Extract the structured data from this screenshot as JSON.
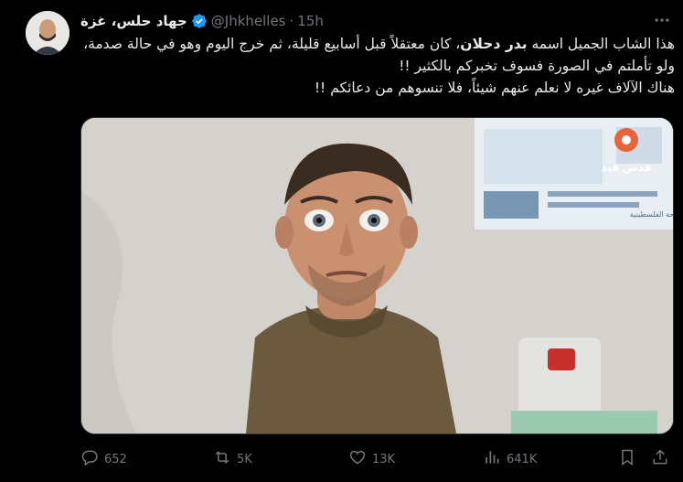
{
  "author": {
    "name": "جهاد حلس، غزة",
    "handle": "@Jhkhelles",
    "separator": "·",
    "time": "15h"
  },
  "tweet": {
    "line1_pre": "هذا الشاب الجميل اسمه ",
    "line1_bold": "بدر دحلان",
    "line1_post": "، كان معتقلاً قبل أسابيع قليلة، ثم خرج اليوم وهو في حالة صدمة، ولو تأملتم في الصورة فسوف تخبركم بالكثير !!",
    "line2": "هناك الآلاف غيره لا نعلم عنهم شيئاً، فلا تنسوهم من دعائكم !!"
  },
  "media": {
    "watermark": "قدس فيد",
    "poster_text": "وزارة الصحة الفلسطينية"
  },
  "actions": {
    "replies": "652",
    "reposts": "5K",
    "likes": "13K",
    "views": "641K"
  },
  "colors": {
    "background": "#000000",
    "text": "#e7e9ea",
    "secondary": "#71767b",
    "verified": "#1d9bf0"
  },
  "icons": [
    "more-icon",
    "verified-icon",
    "reply-icon",
    "repost-icon",
    "like-icon",
    "views-icon",
    "bookmark-icon",
    "share-icon"
  ]
}
